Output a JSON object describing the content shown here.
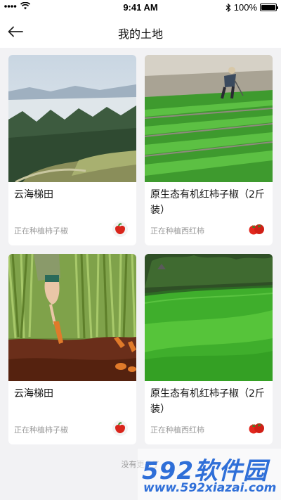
{
  "status_bar": {
    "time": "9:41 AM",
    "battery": "100%",
    "battery_level": 1.0
  },
  "nav": {
    "title": "我的土地",
    "back_icon": "arrow-left-icon"
  },
  "cards": [
    {
      "title": "云海梯田",
      "status": "正在种植柿子椒",
      "icon": "pepper-icon",
      "image": "terraced-fields-mountains"
    },
    {
      "title": "原生态有机红柿子椒（2斤装）",
      "status": "正在种植西红柿",
      "icon": "tomato-icon",
      "image": "farmer-in-green-field"
    },
    {
      "title": "云海梯田",
      "status": "正在种植柿子椒",
      "icon": "pepper-icon",
      "image": "carrot-harvest"
    },
    {
      "title": "原生态有机红柿子椒（2斤装）",
      "status": "正在种植西红柿",
      "icon": "tomato-icon",
      "image": "green-rice-field"
    }
  ],
  "footer": {
    "text": "没有更多了"
  },
  "watermark": {
    "brand": "592软件园",
    "url": "www.592xiazai.com"
  },
  "colors": {
    "background": "#f2f2f4",
    "card": "#ffffff",
    "muted_text": "#9a9a9a",
    "watermark": "#2f6fd8"
  }
}
